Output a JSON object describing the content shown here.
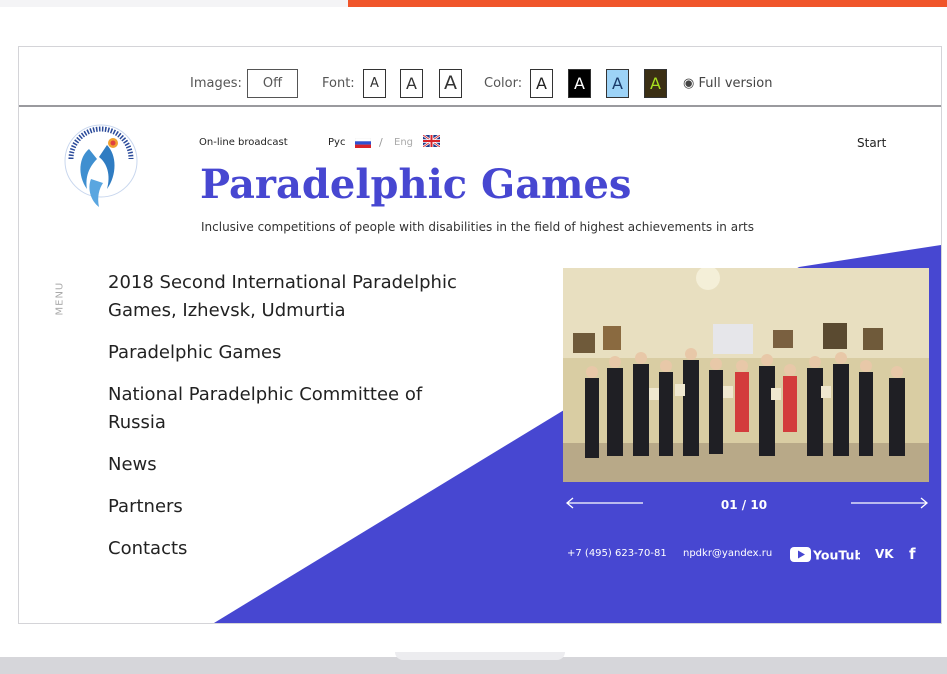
{
  "accessibility_bar": {
    "images_label": "Images:",
    "images_value": "Off",
    "font_label": "Font:",
    "font_sizes": [
      "A",
      "A",
      "A"
    ],
    "color_label": "Color:",
    "color_schemes": [
      {
        "letter": "A",
        "bg": "#ffffff",
        "fg": "#222222"
      },
      {
        "letter": "A",
        "bg": "#000000",
        "fg": "#ffffff"
      },
      {
        "letter": "A",
        "bg": "#9dd3f7",
        "fg": "#1a3a6a"
      },
      {
        "letter": "A",
        "bg": "#3b2f14",
        "fg": "#a8e020"
      }
    ],
    "full_version": "Full version"
  },
  "header": {
    "broadcast": "On-line broadcast",
    "lang_ru": "Рус",
    "lang_sep": "/",
    "lang_en": "Eng",
    "start": "Start",
    "title": "Paradelphic Games",
    "tagline": "Inclusive competitions of people with disabilities in the field of highest achievements in arts"
  },
  "menu_label": "MENU",
  "nav": [
    "2018 Second International Paradelphic Games, Izhevsk, Udmurtia",
    "Paradelphic Games",
    "National Paradelphic Committee of Russia",
    "News",
    "Partners",
    "Contacts"
  ],
  "slider": {
    "counter": "01 / 10"
  },
  "contacts": {
    "phone": "+7 (495) 623-70-81",
    "email": "npdkr@yandex.ru",
    "youtube": "YouTube",
    "vk": "VK",
    "fb": "f"
  },
  "colors": {
    "brand_blue": "#4747d1",
    "accent_orange": "#f0552a"
  }
}
